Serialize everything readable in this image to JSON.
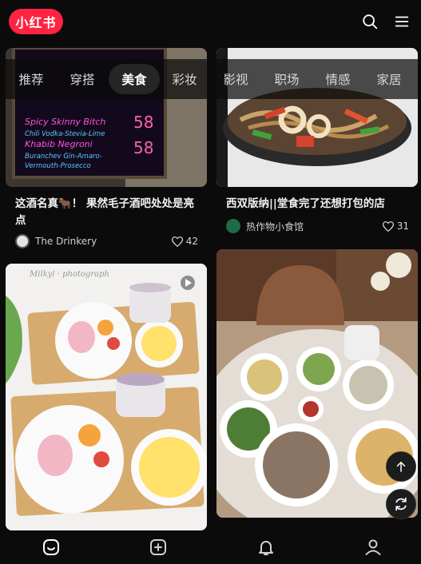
{
  "app": {
    "logo_text": "小红书",
    "brand_color": "#ff2442"
  },
  "header": {
    "icons": [
      "search-icon",
      "menu-icon"
    ]
  },
  "tabs": [
    {
      "label": "推荐",
      "active": false
    },
    {
      "label": "穿搭",
      "active": false
    },
    {
      "label": "美食",
      "active": true
    },
    {
      "label": "彩妆",
      "active": false
    },
    {
      "label": "影视",
      "active": false
    },
    {
      "label": "职场",
      "active": false
    },
    {
      "label": "情感",
      "active": false
    },
    {
      "label": "家居",
      "active": false
    }
  ],
  "feed": {
    "cards": [
      {
        "title": "这酒名真🐂！ 果然毛子酒吧处处是亮点",
        "author": "The Drinkery",
        "likes": "42",
        "image_text": {
          "l1": "Spicy Skinny Bitch",
          "l2": "Chili Vodka-Stevia-Lime",
          "l3": "Khabib Negroni",
          "l4": "Buranchev Gin-Amaro-",
          "l5": "Vermouth-Prosecco",
          "p1": "58",
          "p2": "58"
        }
      },
      {
        "title": "西双版纳||堂食完了还想打包的店",
        "author": "热作物小食馆",
        "likes": "31"
      },
      {
        "title": "",
        "author": "",
        "likes": "",
        "image_text": {
          "watermark": "Milkyl · photograph"
        }
      },
      {
        "title": "",
        "author": "",
        "likes": ""
      }
    ]
  },
  "fab": {
    "top_icon": "arrow-up-icon",
    "refresh_icon": "refresh-icon"
  },
  "bottom_nav": [
    "home-icon",
    "add-post-icon",
    "notification-bell-icon",
    "profile-icon"
  ]
}
